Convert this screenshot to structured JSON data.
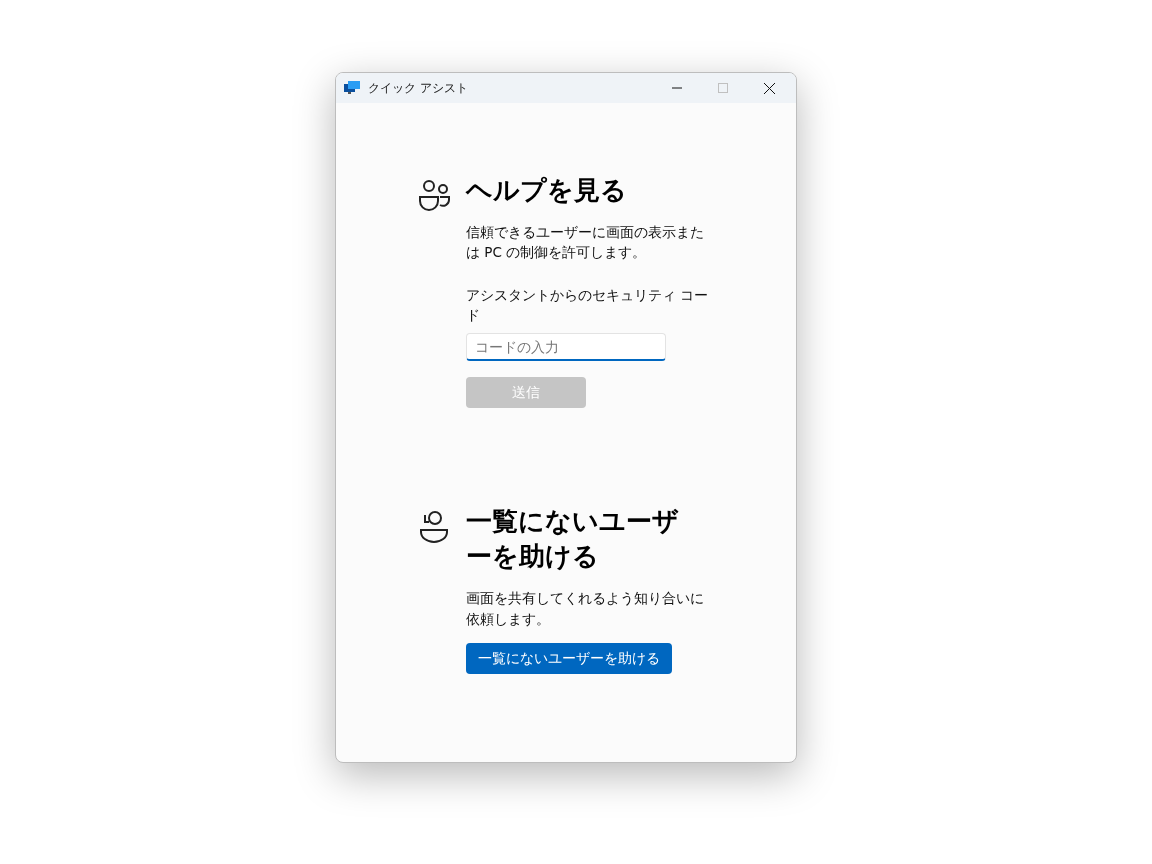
{
  "window": {
    "title": "クイック アシスト",
    "maximize_disabled": true
  },
  "sections": [
    {
      "kind": "get-help",
      "heading": "ヘルプを見る",
      "description": "信頼できるユーザーに画面の表示または PC の制御を許可します。",
      "field_label": "アシスタントからのセキュリティ コード",
      "field": {
        "placeholder": "コードの入力"
      },
      "button": {
        "label": "送信",
        "disabled": true
      }
    },
    {
      "kind": "give-help",
      "heading": "一覧にないユーザーを助ける",
      "description": "画面を共有してくれるよう知り合いに依頼します。",
      "button": {
        "label": "一覧にないユーザーを助ける",
        "disabled": false
      }
    }
  ]
}
